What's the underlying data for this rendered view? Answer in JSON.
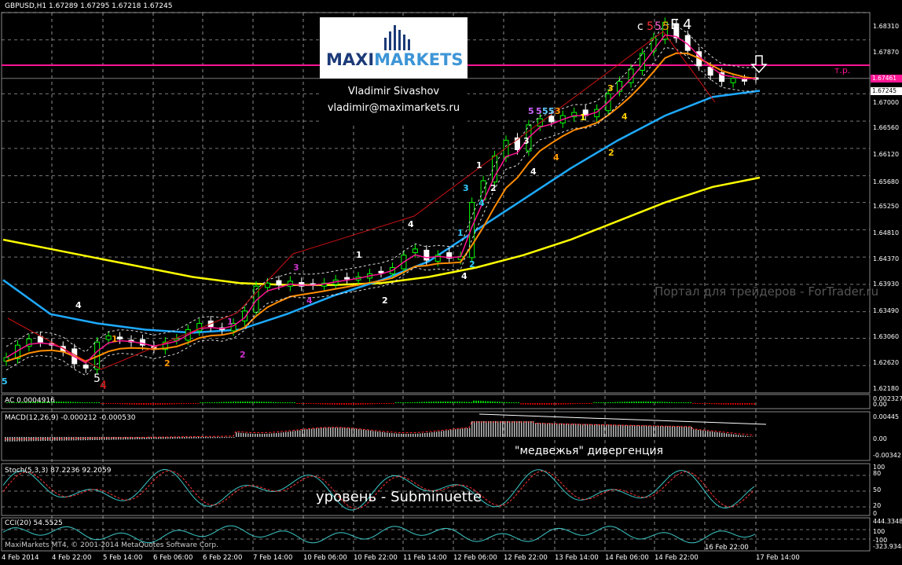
{
  "symbol_info": "GBPUSD,H1  1.67289 1.67295 1.67218 1.67245",
  "logo": {
    "brand_left": "MAXI",
    "brand_right": "MARKETS",
    "author_name": "Vladimir Sivashov",
    "author_email": "vladimir@maximarkets.ru"
  },
  "watermark": "Портал для трейдеров - ForTrader.ru",
  "target_label": "т.р.",
  "price_tags": {
    "target": "1.67461",
    "current": "1.67245"
  },
  "colors": {
    "background": "#000000",
    "grid": "#c8c8c8",
    "up_candle": "#00ff00",
    "down_candle": "#ffffff",
    "ma_fast": "#ff1493",
    "ma_mid": "#ff8c00",
    "ma_slow": "#1eaaff",
    "ma_long": "#ffff00",
    "target_line": "#ff1493"
  },
  "wave_labels": {
    "top_c": "c",
    "top_5a": "5",
    "top_5b": "5",
    "top_5c": "5",
    "top_E": "E",
    "top_4": "4",
    "bottom_5": "5",
    "bottom_4": "4"
  },
  "indicators": {
    "ac": {
      "title": "AC 0.0004916",
      "ticks": [
        "0.002327",
        "0.00"
      ]
    },
    "macd": {
      "title": "MACD(12,26,9) -0.000212 -0.000530",
      "ticks": [
        "0.00445",
        "0.00",
        "-0.00342"
      ],
      "caption": "\"медвежья\" дивергенция"
    },
    "stoch": {
      "title": "Stoch(5,3,3) 87.2236 92.2059",
      "ticks": [
        "100",
        "80",
        "50",
        "20",
        "0"
      ],
      "caption": "уровень - Subminuette"
    },
    "cci": {
      "title": "CCI(20) 54.5525",
      "ticks": [
        "444.3348",
        "100",
        "-100",
        "-323.9348"
      ]
    }
  },
  "price_axis": [
    "1.68310",
    "1.67870",
    "1.67245",
    "1.67000",
    "1.66560",
    "1.66120",
    "1.65680",
    "1.65250",
    "1.64810",
    "1.64370",
    "1.63930",
    "1.63490",
    "1.63060",
    "1.62620",
    "1.62180"
  ],
  "time_axis": [
    "4 Feb 2014",
    "4 Feb 22:00",
    "5 Feb 14:00",
    "6 Feb 06:00",
    "6 Feb 22:00",
    "7 Feb 14:00",
    "10 Feb 06:00",
    "10 Feb 22:00",
    "11 Feb 14:00",
    "12 Feb 06:00",
    "12 Feb 22:00",
    "13 Feb 14:00",
    "14 Feb 06:00",
    "14 Feb 22:00",
    "16 Feb 22:00",
    "17 Feb 14:00"
  ],
  "footer": "MaxiMarkets MT4, © 2001-2014 MetaQuotes Software Corp.",
  "chart_data": {
    "type": "candlestick",
    "symbol": "GBPUSD",
    "timeframe": "H1",
    "ylim": [
      1.6218,
      1.6831
    ],
    "target_level": 1.67461,
    "series": [
      {
        "name": "close",
        "values": [
          1.6275,
          1.6295,
          1.6305,
          1.63,
          1.6295,
          1.6285,
          1.6265,
          1.6258,
          1.63,
          1.631,
          1.6305,
          1.63,
          1.6295,
          1.629,
          1.63,
          1.6305,
          1.632,
          1.633,
          1.6325,
          1.632,
          1.633,
          1.635,
          1.639,
          1.6395,
          1.6392,
          1.6398,
          1.639,
          1.6392,
          1.6395,
          1.64,
          1.6402,
          1.6405,
          1.641,
          1.6412,
          1.642,
          1.644,
          1.645,
          1.6432,
          1.644,
          1.6435,
          1.6438,
          1.6525,
          1.656,
          1.66,
          1.6625,
          1.661,
          1.665,
          1.666,
          1.6655,
          1.6665,
          1.667,
          1.6665,
          1.6675,
          1.67,
          1.672,
          1.674,
          1.6765,
          1.679,
          1.6815,
          1.679,
          1.677,
          1.6745,
          1.673,
          1.672,
          1.6725,
          1.6722,
          1.6725
        ]
      }
    ],
    "moving_averages": [
      {
        "name": "ma_long",
        "color": "#ffff00",
        "values": [
          1.6465,
          1.645,
          1.6435,
          1.642,
          1.6405,
          1.6395,
          1.6392,
          1.6392,
          1.6395,
          1.6405,
          1.642,
          1.644,
          1.6465,
          1.6495,
          1.6525,
          1.655,
          1.6565
        ]
      },
      {
        "name": "ma_slow",
        "color": "#1eaaff",
        "values": [
          1.64,
          1.6345,
          1.633,
          1.632,
          1.6315,
          1.632,
          1.6345,
          1.6375,
          1.64,
          1.643,
          1.648,
          1.653,
          1.658,
          1.6625,
          1.6665,
          1.6695,
          1.6705
        ]
      }
    ]
  }
}
